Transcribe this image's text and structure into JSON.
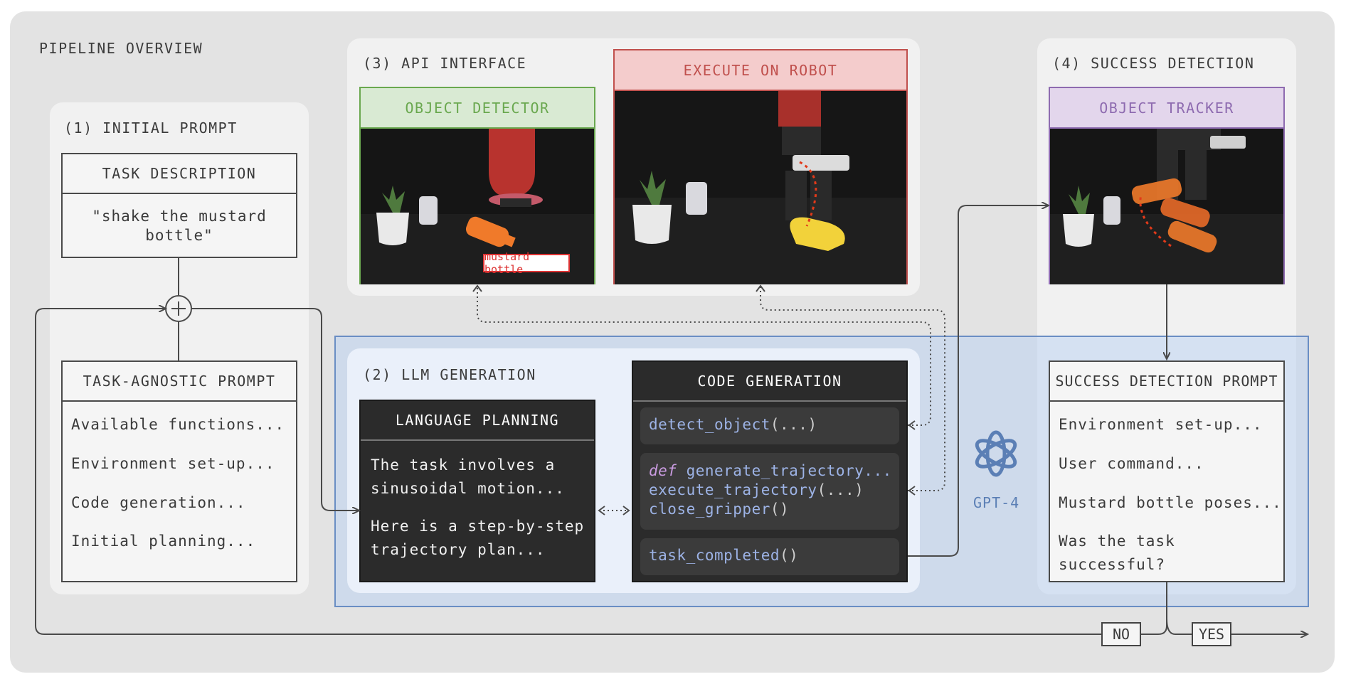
{
  "overview_title": "PIPELINE OVERVIEW",
  "initial_prompt": {
    "title": "(1) INITIAL PROMPT",
    "task_box": {
      "header": "TASK DESCRIPTION",
      "text_line1": "\"shake the mustard",
      "text_line2": "bottle\""
    },
    "agnostic_box": {
      "header": "TASK-AGNOSTIC PROMPT",
      "lines": [
        "Available functions...",
        "Environment set-up...",
        "Code generation...",
        "Initial planning..."
      ]
    }
  },
  "api_interface": {
    "title": "(3) API INTERFACE",
    "detector": {
      "header": "OBJECT DETECTOR",
      "detection_label": "mustard bottle"
    },
    "robot": {
      "header": "EXECUTE ON ROBOT"
    }
  },
  "success_detection": {
    "title": "(4) SUCCESS DETECTION",
    "tracker": {
      "header": "OBJECT TRACKER"
    },
    "prompt_box": {
      "header": "SUCCESS DETECTION PROMPT",
      "lines": [
        "Environment set-up...",
        "User command...",
        "Mustard bottle poses...",
        "Was the task",
        "successful?"
      ]
    }
  },
  "llm_generation": {
    "title": "(2) LLM GENERATION",
    "language_planning": {
      "header": "LANGUAGE PLANNING",
      "lines": [
        "The task involves a",
        "sinusoidal motion...",
        "Here is a step-by-step",
        "trajectory plan..."
      ]
    },
    "code_generation": {
      "header": "CODE GENERATION",
      "chip1": {
        "fn": "detect_object",
        "args": "(...)"
      },
      "chip2": {
        "kw": "def",
        "line1": " generate_trajectory...",
        "fn2": "execute_trajectory",
        "args2": "(...)",
        "fn3": "close_gripper",
        "args3": "()"
      },
      "chip3": {
        "fn": "task_completed",
        "args": "()"
      }
    },
    "model_label": "GPT-4"
  },
  "decisions": {
    "no": "NO",
    "yes": "YES"
  },
  "colors": {
    "detector_green": "#6aa84f",
    "robot_red": "#c0504d",
    "tracker_purple": "#8e6bb0",
    "llm_blue": "#5b7fb5",
    "code_blue": "#9db3e6",
    "keyword_purple": "#c99be0"
  }
}
